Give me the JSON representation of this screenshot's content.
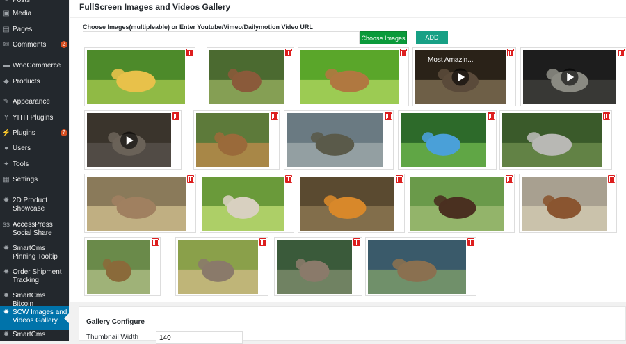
{
  "sidebar": {
    "items": [
      {
        "label": "Posts",
        "icon": "pin-icon"
      },
      {
        "label": "Media",
        "icon": "media-icon"
      },
      {
        "label": "Pages",
        "icon": "pages-icon"
      },
      {
        "label": "Comments",
        "icon": "comment-icon",
        "badge": "2"
      },
      {
        "label": "WooCommerce",
        "icon": "woo-icon"
      },
      {
        "label": "Products",
        "icon": "products-icon"
      },
      {
        "label": "Appearance",
        "icon": "brush-icon"
      },
      {
        "label": "YITH Plugins",
        "icon": "yith-icon"
      },
      {
        "label": "Plugins",
        "icon": "plugin-icon",
        "badge": "7"
      },
      {
        "label": "Users",
        "icon": "users-icon"
      },
      {
        "label": "Tools",
        "icon": "wrench-icon"
      },
      {
        "label": "Settings",
        "icon": "settings-icon"
      },
      {
        "label": "2D Product Showcase",
        "icon": "gear-icon"
      },
      {
        "label": "AccessPress Social Share",
        "icon": "ss-icon"
      },
      {
        "label": "SmartCms Pinning Tooltip",
        "icon": "gear-icon"
      },
      {
        "label": "Order Shipment Tracking",
        "icon": "gear-icon"
      },
      {
        "label": "SmartCms Bitcoin",
        "icon": "gear-icon"
      },
      {
        "label": "SCW Images and Videos Gallery",
        "icon": "gear-icon",
        "active": true
      },
      {
        "label": "SmartCms",
        "icon": "gear-icon"
      }
    ]
  },
  "page": {
    "title": "FullScreen Images and Videos Gallery"
  },
  "form": {
    "label": "Choose Images(multipleable) or Enter Youtube/Vimeo/Dailymotion Video URL",
    "url_value": "",
    "choose_label": "Choose Images",
    "add_label": "ADD"
  },
  "video_title": "Most Amazin...",
  "gallery": [
    {
      "subject": "ducklings",
      "kind": "image"
    },
    {
      "subject": "antelopes-fighting",
      "kind": "image"
    },
    {
      "subject": "impalas",
      "kind": "image"
    },
    {
      "subject": "video",
      "kind": "video"
    },
    {
      "subject": "video",
      "kind": "video"
    },
    {
      "subject": "video",
      "kind": "video"
    },
    {
      "subject": "camels",
      "kind": "image"
    },
    {
      "subject": "crocodile-bird",
      "kind": "image"
    },
    {
      "subject": "roller-bird",
      "kind": "image"
    },
    {
      "subject": "koala",
      "kind": "image"
    },
    {
      "subject": "cougar-cub",
      "kind": "image"
    },
    {
      "subject": "chick",
      "kind": "image"
    },
    {
      "subject": "tiger",
      "kind": "image"
    },
    {
      "subject": "bison",
      "kind": "image"
    },
    {
      "subject": "bear",
      "kind": "image"
    },
    {
      "subject": "hyena",
      "kind": "image"
    },
    {
      "subject": "rhino",
      "kind": "image"
    },
    {
      "subject": "sea-lions",
      "kind": "image"
    },
    {
      "subject": "marmot",
      "kind": "image"
    }
  ],
  "config": {
    "title": "Gallery Configure",
    "thumb_label": "Thumbnail Width",
    "thumb_value": "140"
  },
  "colors": {
    "sidebar": "#23282d",
    "active": "#0073aa",
    "choose": "#0a9a3a",
    "add": "#17a085",
    "delete": "#dd1e1e"
  }
}
